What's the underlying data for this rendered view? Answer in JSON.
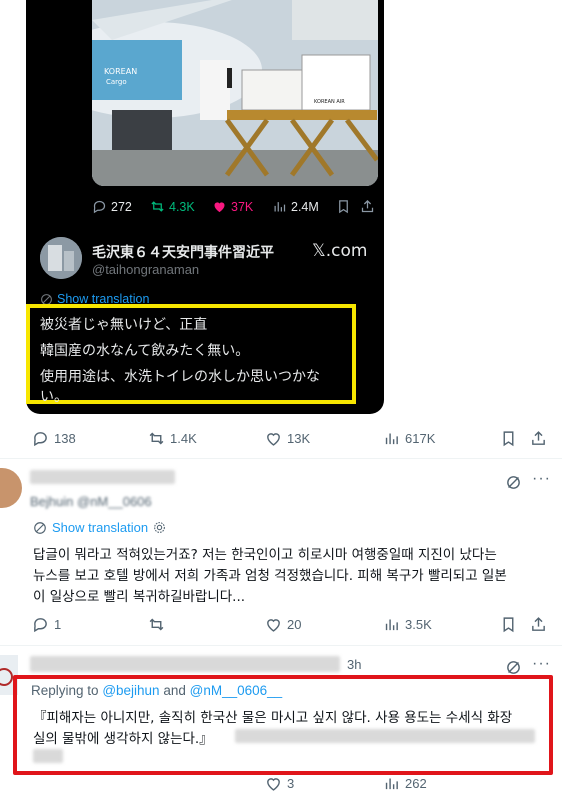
{
  "embedded_tweet": {
    "stats": {
      "replies": "272",
      "reposts": "4.3K",
      "likes": "37K",
      "views": "2.4M"
    },
    "author_name": "毛沢東６４天安門事件習近平",
    "author_handle": "@taihongranaman",
    "source": "𝕏.com",
    "show_translation": "Show translation",
    "text_lines": [
      "被災者じゃ無いけど、正直",
      "韓国産の水なんて飲みたく無い。",
      "使用用途は、水洗トイレの水しか思いつかな",
      "い。"
    ],
    "photo_signs": [
      "KOREAN",
      "Cargo",
      "KOREAN AIR"
    ]
  },
  "main_tweet_stats": {
    "replies": "138",
    "reposts": "1.4K",
    "likes": "13K",
    "views": "617K"
  },
  "reply1": {
    "name_partial": "Bejhuin",
    "handle_partial": "@nM__0606",
    "show_translation": "Show translation",
    "text_lines": [
      "답글이 뭐라고 적혀있는거죠? 저는 한국인이고 히로시마 여행중일때 지진이 났다는",
      "뉴스를 보고 호텔 방에서 저희 가족과 엄청 걱정했습니다. 피해 복구가 빨리되고 일본",
      "이 일상으로 빨리 복귀하길바랍니다..."
    ],
    "stats": {
      "replies": "1",
      "reposts": "",
      "likes": "20",
      "views": "3.5K"
    }
  },
  "reply2": {
    "time": "3h",
    "replying_to_label": "Replying to",
    "replying_to_user1": "@bejihun",
    "and_label": "and",
    "replying_to_user2": "@nM__0606__",
    "text_lines": [
      "『피해자는 아니지만, 솔직히 한국산 물은 마시고 싶지 않다. 사용 용도는 수세식 화장",
      "실의 물밖에 생각하지 않는다.』"
    ],
    "stats": {
      "likes": "3",
      "views": "262"
    }
  },
  "colors": {
    "highlight_yellow": "#f7e600",
    "highlight_red": "#e0151a",
    "link_blue": "#1d9bf0",
    "like_pink": "#f91880",
    "repost_green": "#00ba7c"
  }
}
